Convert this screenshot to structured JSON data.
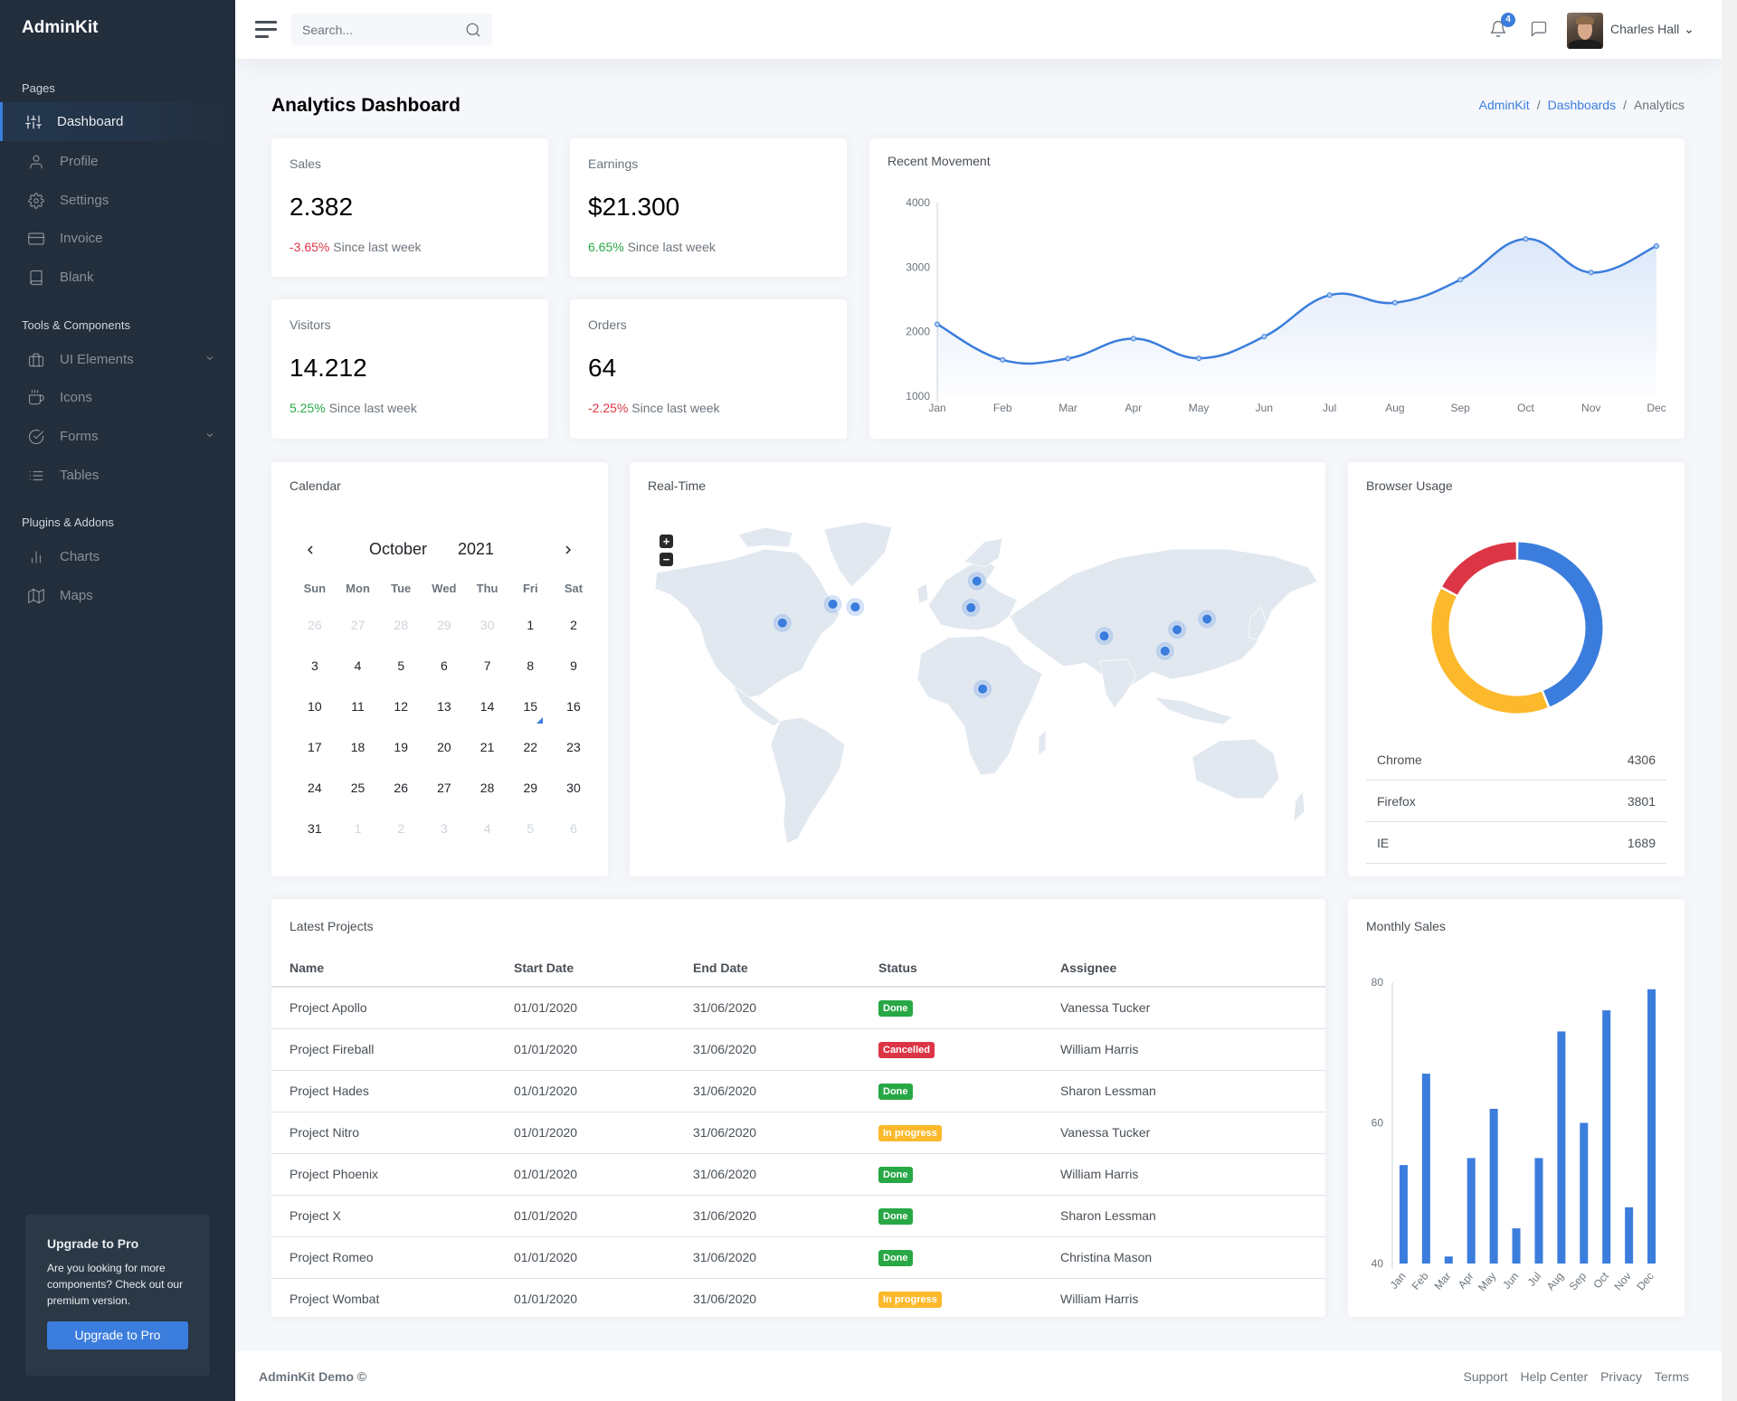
{
  "app": {
    "brand": "AdminKit"
  },
  "sidebar": {
    "sections": [
      {
        "header": "Pages"
      },
      {
        "header": "Tools & Components"
      },
      {
        "header": "Plugins & Addons"
      }
    ],
    "items": [
      {
        "label": "Dashboard",
        "icon": "sliders-icon",
        "active": true
      },
      {
        "label": "Profile",
        "icon": "user-icon"
      },
      {
        "label": "Settings",
        "icon": "settings-icon"
      },
      {
        "label": "Invoice",
        "icon": "credit-card-icon"
      },
      {
        "label": "Blank",
        "icon": "book-icon"
      },
      {
        "label": "UI Elements",
        "icon": "briefcase-icon",
        "expandable": true
      },
      {
        "label": "Icons",
        "icon": "coffee-icon"
      },
      {
        "label": "Forms",
        "icon": "check-circle-icon",
        "expandable": true
      },
      {
        "label": "Tables",
        "icon": "list-icon"
      },
      {
        "label": "Charts",
        "icon": "bar-chart-icon"
      },
      {
        "label": "Maps",
        "icon": "map-icon"
      }
    ],
    "upgrade": {
      "title": "Upgrade to Pro",
      "text": "Are you looking for more components? Check out our premium version.",
      "button": "Upgrade to Pro"
    }
  },
  "navbar": {
    "search_placeholder": "Search...",
    "notification_count": "4",
    "user_name": "Charles Hall"
  },
  "page": {
    "title_bold": "Analytics",
    "title_rest": " Dashboard",
    "breadcrumb": [
      "AdminKit",
      "Dashboards",
      "Analytics"
    ]
  },
  "stats": [
    {
      "label": "Sales",
      "value": "2.382",
      "change": "-3.65%",
      "trend": "down",
      "suffix": "Since last week"
    },
    {
      "label": "Earnings",
      "value": "$21.300",
      "change": "6.65%",
      "trend": "up",
      "suffix": "Since last week"
    },
    {
      "label": "Visitors",
      "value": "14.212",
      "change": "5.25%",
      "trend": "up",
      "suffix": "Since last week"
    },
    {
      "label": "Orders",
      "value": "64",
      "change": "-2.25%",
      "trend": "down",
      "suffix": "Since last week"
    }
  ],
  "calendar": {
    "title": "Calendar",
    "month": "October",
    "year": "2021",
    "weekdays": [
      "Sun",
      "Mon",
      "Tue",
      "Wed",
      "Thu",
      "Fri",
      "Sat"
    ],
    "weeks": [
      [
        [
          "26",
          1
        ],
        [
          "27",
          1
        ],
        [
          "28",
          1
        ],
        [
          "29",
          1
        ],
        [
          "30",
          1
        ],
        [
          "1",
          0
        ],
        [
          "2",
          0
        ]
      ],
      [
        [
          "3",
          0
        ],
        [
          "4",
          0
        ],
        [
          "5",
          0
        ],
        [
          "6",
          0
        ],
        [
          "7",
          0
        ],
        [
          "8",
          0
        ],
        [
          "9",
          0
        ]
      ],
      [
        [
          "10",
          0
        ],
        [
          "11",
          0
        ],
        [
          "12",
          0
        ],
        [
          "13",
          0
        ],
        [
          "14",
          0
        ],
        [
          "15",
          0
        ],
        [
          "16",
          0
        ]
      ],
      [
        [
          "17",
          0
        ],
        [
          "18",
          0
        ],
        [
          "19",
          0
        ],
        [
          "20",
          0
        ],
        [
          "21",
          0
        ],
        [
          "22",
          0
        ],
        [
          "23",
          0
        ]
      ],
      [
        [
          "24",
          0
        ],
        [
          "25",
          0
        ],
        [
          "26",
          0
        ],
        [
          "27",
          0
        ],
        [
          "28",
          0
        ],
        [
          "29",
          0
        ],
        [
          "30",
          0
        ]
      ],
      [
        [
          "31",
          0
        ],
        [
          "1",
          1
        ],
        [
          "2",
          1
        ],
        [
          "3",
          1
        ],
        [
          "4",
          1
        ],
        [
          "5",
          1
        ],
        [
          "6",
          1
        ]
      ]
    ],
    "today": "15"
  },
  "realtime": {
    "title": "Real-Time",
    "zoom_in": "+",
    "zoom_out": "−",
    "markers": [
      {
        "name": "Los Angeles",
        "lat": 34.05,
        "lng": -118.24
      },
      {
        "name": "Chicago",
        "lat": 41.88,
        "lng": -87.63
      },
      {
        "name": "New York",
        "lat": 40.71,
        "lng": -74.0
      },
      {
        "name": "London",
        "lat": 51.51,
        "lng": -0.13
      },
      {
        "name": "Madrid",
        "lat": 40.42,
        "lng": -3.7
      },
      {
        "name": "Lagos",
        "lat": 6.52,
        "lng": 3.38
      },
      {
        "name": "New Delhi",
        "lat": 28.61,
        "lng": 77.21
      },
      {
        "name": "Hong Kong",
        "lat": 22.32,
        "lng": 114.17
      },
      {
        "name": "Shanghai",
        "lat": 31.23,
        "lng": 121.47
      },
      {
        "name": "Tokyo",
        "lat": 35.68,
        "lng": 139.69
      }
    ]
  },
  "browser_usage": {
    "title": "Browser Usage",
    "rows": [
      {
        "name": "Chrome",
        "value": "4306",
        "color": "#3b7ddd"
      },
      {
        "name": "Firefox",
        "value": "3801",
        "color": "#fcb92c"
      },
      {
        "name": "IE",
        "value": "1689",
        "color": "#dc3545"
      }
    ]
  },
  "projects": {
    "title": "Latest Projects",
    "columns": [
      "Name",
      "Start Date",
      "End Date",
      "Status",
      "Assignee"
    ],
    "rows": [
      {
        "name": "Project Apollo",
        "start": "01/01/2020",
        "end": "31/06/2020",
        "status": "Done",
        "assignee": "Vanessa Tucker"
      },
      {
        "name": "Project Fireball",
        "start": "01/01/2020",
        "end": "31/06/2020",
        "status": "Cancelled",
        "assignee": "William Harris"
      },
      {
        "name": "Project Hades",
        "start": "01/01/2020",
        "end": "31/06/2020",
        "status": "Done",
        "assignee": "Sharon Lessman"
      },
      {
        "name": "Project Nitro",
        "start": "01/01/2020",
        "end": "31/06/2020",
        "status": "In progress",
        "assignee": "Vanessa Tucker"
      },
      {
        "name": "Project Phoenix",
        "start": "01/01/2020",
        "end": "31/06/2020",
        "status": "Done",
        "assignee": "William Harris"
      },
      {
        "name": "Project X",
        "start": "01/01/2020",
        "end": "31/06/2020",
        "status": "Done",
        "assignee": "Sharon Lessman"
      },
      {
        "name": "Project Romeo",
        "start": "01/01/2020",
        "end": "31/06/2020",
        "status": "Done",
        "assignee": "Christina Mason"
      },
      {
        "name": "Project Wombat",
        "start": "01/01/2020",
        "end": "31/06/2020",
        "status": "In progress",
        "assignee": "William Harris"
      }
    ],
    "status_colors": {
      "Done": "#28a745",
      "Cancelled": "#dc3545",
      "In progress": "#fcb92c"
    }
  },
  "footer": {
    "copyright": "AdminKit Demo ©",
    "links": [
      "Support",
      "Help Center",
      "Privacy",
      "Terms"
    ]
  },
  "colors": {
    "primary": "#3b7ddd",
    "success": "#28a745",
    "danger": "#dc3545",
    "warning": "#fcb92c",
    "sidebar": "#222e3c"
  },
  "chart_data": [
    {
      "type": "area",
      "title": "Recent Movement",
      "categories": [
        "Jan",
        "Feb",
        "Mar",
        "Apr",
        "May",
        "Jun",
        "Jul",
        "Aug",
        "Sep",
        "Oct",
        "Nov",
        "Dec"
      ],
      "values": [
        2115,
        1562,
        1584,
        1892,
        1587,
        1923,
        2566,
        2448,
        2805,
        3438,
        2917,
        3327
      ],
      "yticks": [
        1000,
        2000,
        3000,
        4000
      ],
      "ylim": [
        1000,
        4000
      ],
      "xlabel": "",
      "ylabel": "",
      "grid": false,
      "color": "#3b7ddd"
    },
    {
      "type": "pie",
      "title": "Browser Usage",
      "categories": [
        "Chrome",
        "Firefox",
        "IE"
      ],
      "values": [
        4306,
        3801,
        1689
      ],
      "colors": [
        "#3b7ddd",
        "#fcb92c",
        "#dc3545"
      ],
      "donut": true
    },
    {
      "type": "bar",
      "title": "Monthly Sales",
      "categories": [
        "Jan",
        "Feb",
        "Mar",
        "Apr",
        "May",
        "Jun",
        "Jul",
        "Aug",
        "Sep",
        "Oct",
        "Nov",
        "Dec"
      ],
      "values": [
        54,
        67,
        41,
        55,
        62,
        45,
        55,
        73,
        60,
        76,
        48,
        79
      ],
      "yticks": [
        40,
        60,
        80
      ],
      "ylim": [
        40,
        80
      ],
      "xlabel": "",
      "ylabel": "",
      "grid": false,
      "color": "#3b7ddd"
    }
  ]
}
